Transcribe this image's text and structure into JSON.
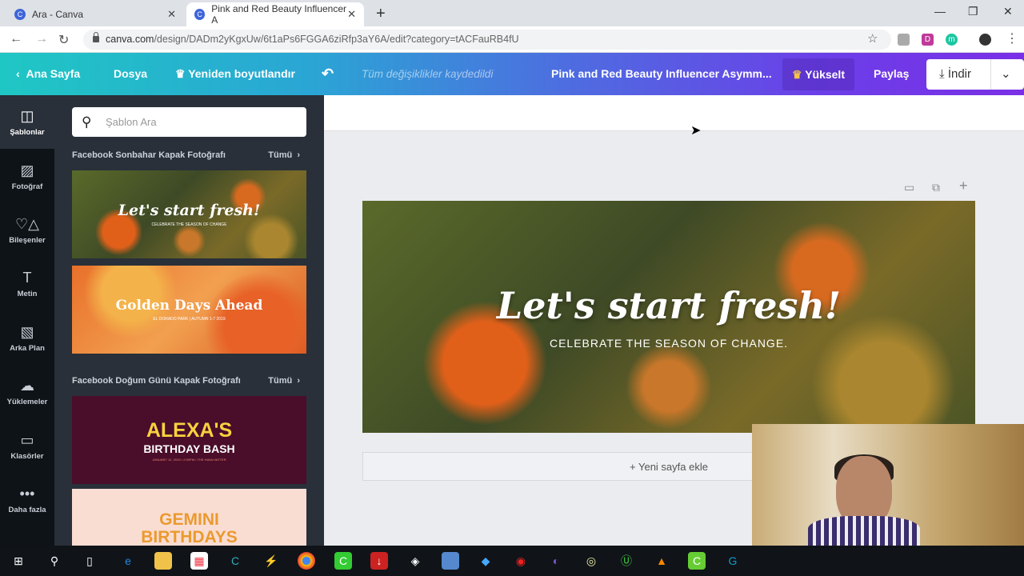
{
  "browser": {
    "tabs": [
      {
        "title": "Ara - Canva"
      },
      {
        "title": "Pink and Red Beauty Influencer A"
      }
    ],
    "url_host": "canva.com",
    "url_path": "/design/DADm2yKgxUw/6t1aPs6FGGA6ziRfp3aY6A/edit?category=tACFauRB4fU",
    "ext_d": "D",
    "ext_m": "m"
  },
  "header": {
    "home": "Ana Sayfa",
    "file": "Dosya",
    "resize": "Yeniden boyutlandır",
    "status": "Tüm değişiklikler kaydedildi",
    "title": "Pink and Red Beauty Influencer Asymm...",
    "upgrade": "Yükselt",
    "share": "Paylaş",
    "download": "İndir"
  },
  "sidebar": {
    "items": [
      {
        "label": "Şablonlar",
        "icon": "templates-icon",
        "glyph": "◫"
      },
      {
        "label": "Fotoğraf",
        "icon": "photo-icon",
        "glyph": "▨"
      },
      {
        "label": "Bileşenler",
        "icon": "elements-icon",
        "glyph": "♡△"
      },
      {
        "label": "Metin",
        "icon": "text-icon",
        "glyph": "T"
      },
      {
        "label": "Arka Plan",
        "icon": "background-icon",
        "glyph": "▧"
      },
      {
        "label": "Yüklemeler",
        "icon": "upload-icon",
        "glyph": "☁"
      },
      {
        "label": "Klasörler",
        "icon": "folder-icon",
        "glyph": "▭"
      },
      {
        "label": "Daha fazla",
        "icon": "more-icon",
        "glyph": "•••"
      }
    ]
  },
  "panel": {
    "search_placeholder": "Şablon Ara",
    "sections": [
      {
        "title": "Facebook Sonbahar Kapak Fotoğrafı",
        "all": "Tümü"
      },
      {
        "title": "Facebook Doğum Günü Kapak Fotoğrafı",
        "all": "Tümü"
      }
    ],
    "thumbs": [
      {
        "title": "Let's start fresh!",
        "sub": "CELEBRATE THE SEASON OF CHANGE"
      },
      {
        "title": "Golden Days Ahead",
        "sub": "EL DORADO PARK | AUTUMN 1-7 2019"
      },
      {
        "title": "ALEXA'S",
        "title2": "BIRTHDAY BASH",
        "sub": "JANUARY 12, 2019 • 2:00PM • THE HAVA HATTER"
      },
      {
        "title": "GEMINI",
        "title2": "BIRTHDAYS"
      }
    ]
  },
  "design": {
    "title": "Let's start fresh!",
    "subtitle": "CELEBRATE THE SEASON OF CHANGE.",
    "add_page": "+ Yeni sayfa ekle"
  }
}
